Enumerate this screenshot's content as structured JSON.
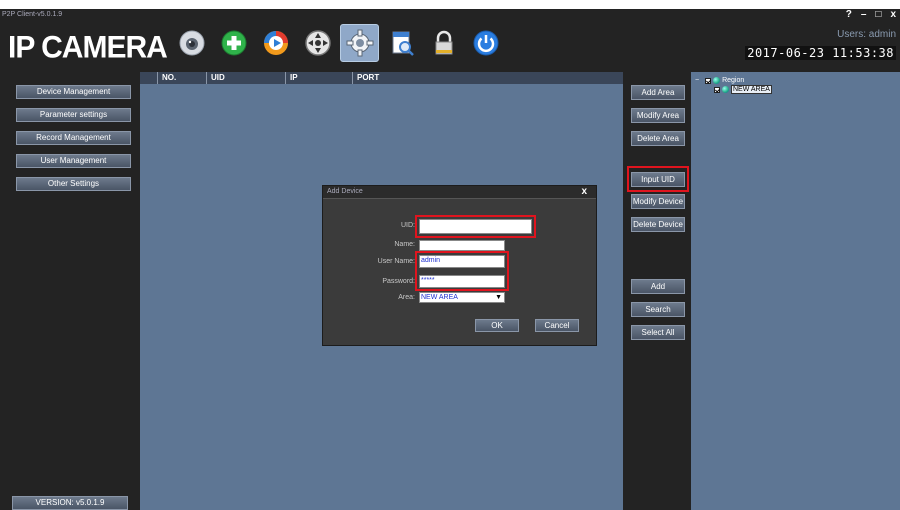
{
  "window": {
    "title": "P2P Client-v5.0.1.9",
    "controls": {
      "help": "?",
      "minimize": "–",
      "maximize": "□",
      "close": "x"
    }
  },
  "header": {
    "logo": "IP CAMERA",
    "users_label": "Users: admin",
    "datetime": "2017-06-23 11:53:38",
    "toolbar": [
      {
        "icon": "camera-icon"
      },
      {
        "icon": "add-device-icon"
      },
      {
        "icon": "playback-icon"
      },
      {
        "icon": "ptz-control-icon"
      },
      {
        "icon": "settings-gear-icon",
        "active": true
      },
      {
        "icon": "file-search-icon"
      },
      {
        "icon": "lock-icon"
      },
      {
        "icon": "power-icon"
      }
    ]
  },
  "sidebar": {
    "items": [
      {
        "label": "Device Management"
      },
      {
        "label": "Parameter settings"
      },
      {
        "label": "Record Management"
      },
      {
        "label": "User Management"
      },
      {
        "label": "Other Settings"
      }
    ],
    "version": "VERSION: v5.0.1.9"
  },
  "table": {
    "columns": [
      "NO.",
      "UID",
      "IP",
      "PORT"
    ]
  },
  "actions": {
    "add_area": "Add Area",
    "modify_area": "Modify Area",
    "delete_area": "Delete Area",
    "input_uid": "Input UID",
    "modify_device": "Modify Device",
    "delete_device": "Delete Device",
    "add": "Add",
    "search": "Search",
    "select_all": "Select All"
  },
  "tree": {
    "expander": "−",
    "root": "Region",
    "child": "NEW AREA"
  },
  "dialog": {
    "title": "Add Device",
    "close": "x",
    "fields": {
      "uid_label": "UID:",
      "uid_value": "",
      "name_label": "Name:",
      "name_value": "",
      "username_label": "User Name:",
      "username_value": "admin",
      "password_label": "Password:",
      "password_value": "*****",
      "area_label": "Area:",
      "area_value": "NEW AREA"
    },
    "ok": "OK",
    "cancel": "Cancel"
  },
  "colors": {
    "panel_blue": "#5e7694",
    "dark_bg": "#232323",
    "highlight_red": "#e0141e",
    "input_text": "#1d2fd0"
  }
}
